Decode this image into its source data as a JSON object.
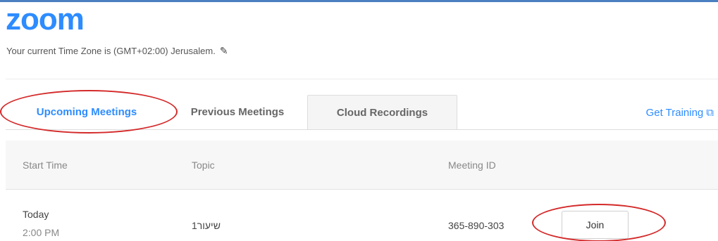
{
  "app": {
    "logo_text": "zoom",
    "timezone_text": "Your current Time Zone is (GMT+02:00) Jerusalem.",
    "edit_icon": "pencil-icon"
  },
  "tabs": [
    {
      "label": "Upcoming Meetings",
      "active": true
    },
    {
      "label": "Previous Meetings",
      "active": false
    },
    {
      "label": "Cloud Recordings",
      "active": false
    }
  ],
  "get_training": {
    "label": "Get Training",
    "icon": "external-link-icon"
  },
  "table": {
    "headers": {
      "start_time": "Start Time",
      "topic": "Topic",
      "meeting_id": "Meeting ID"
    },
    "rows": [
      {
        "date": "Today",
        "time": "2:00 PM",
        "topic": "שיעור1",
        "meeting_id": "365-890-303",
        "action": "Join"
      }
    ]
  },
  "colors": {
    "brand": "#2d8cff",
    "annotation": "#d42a2a"
  }
}
